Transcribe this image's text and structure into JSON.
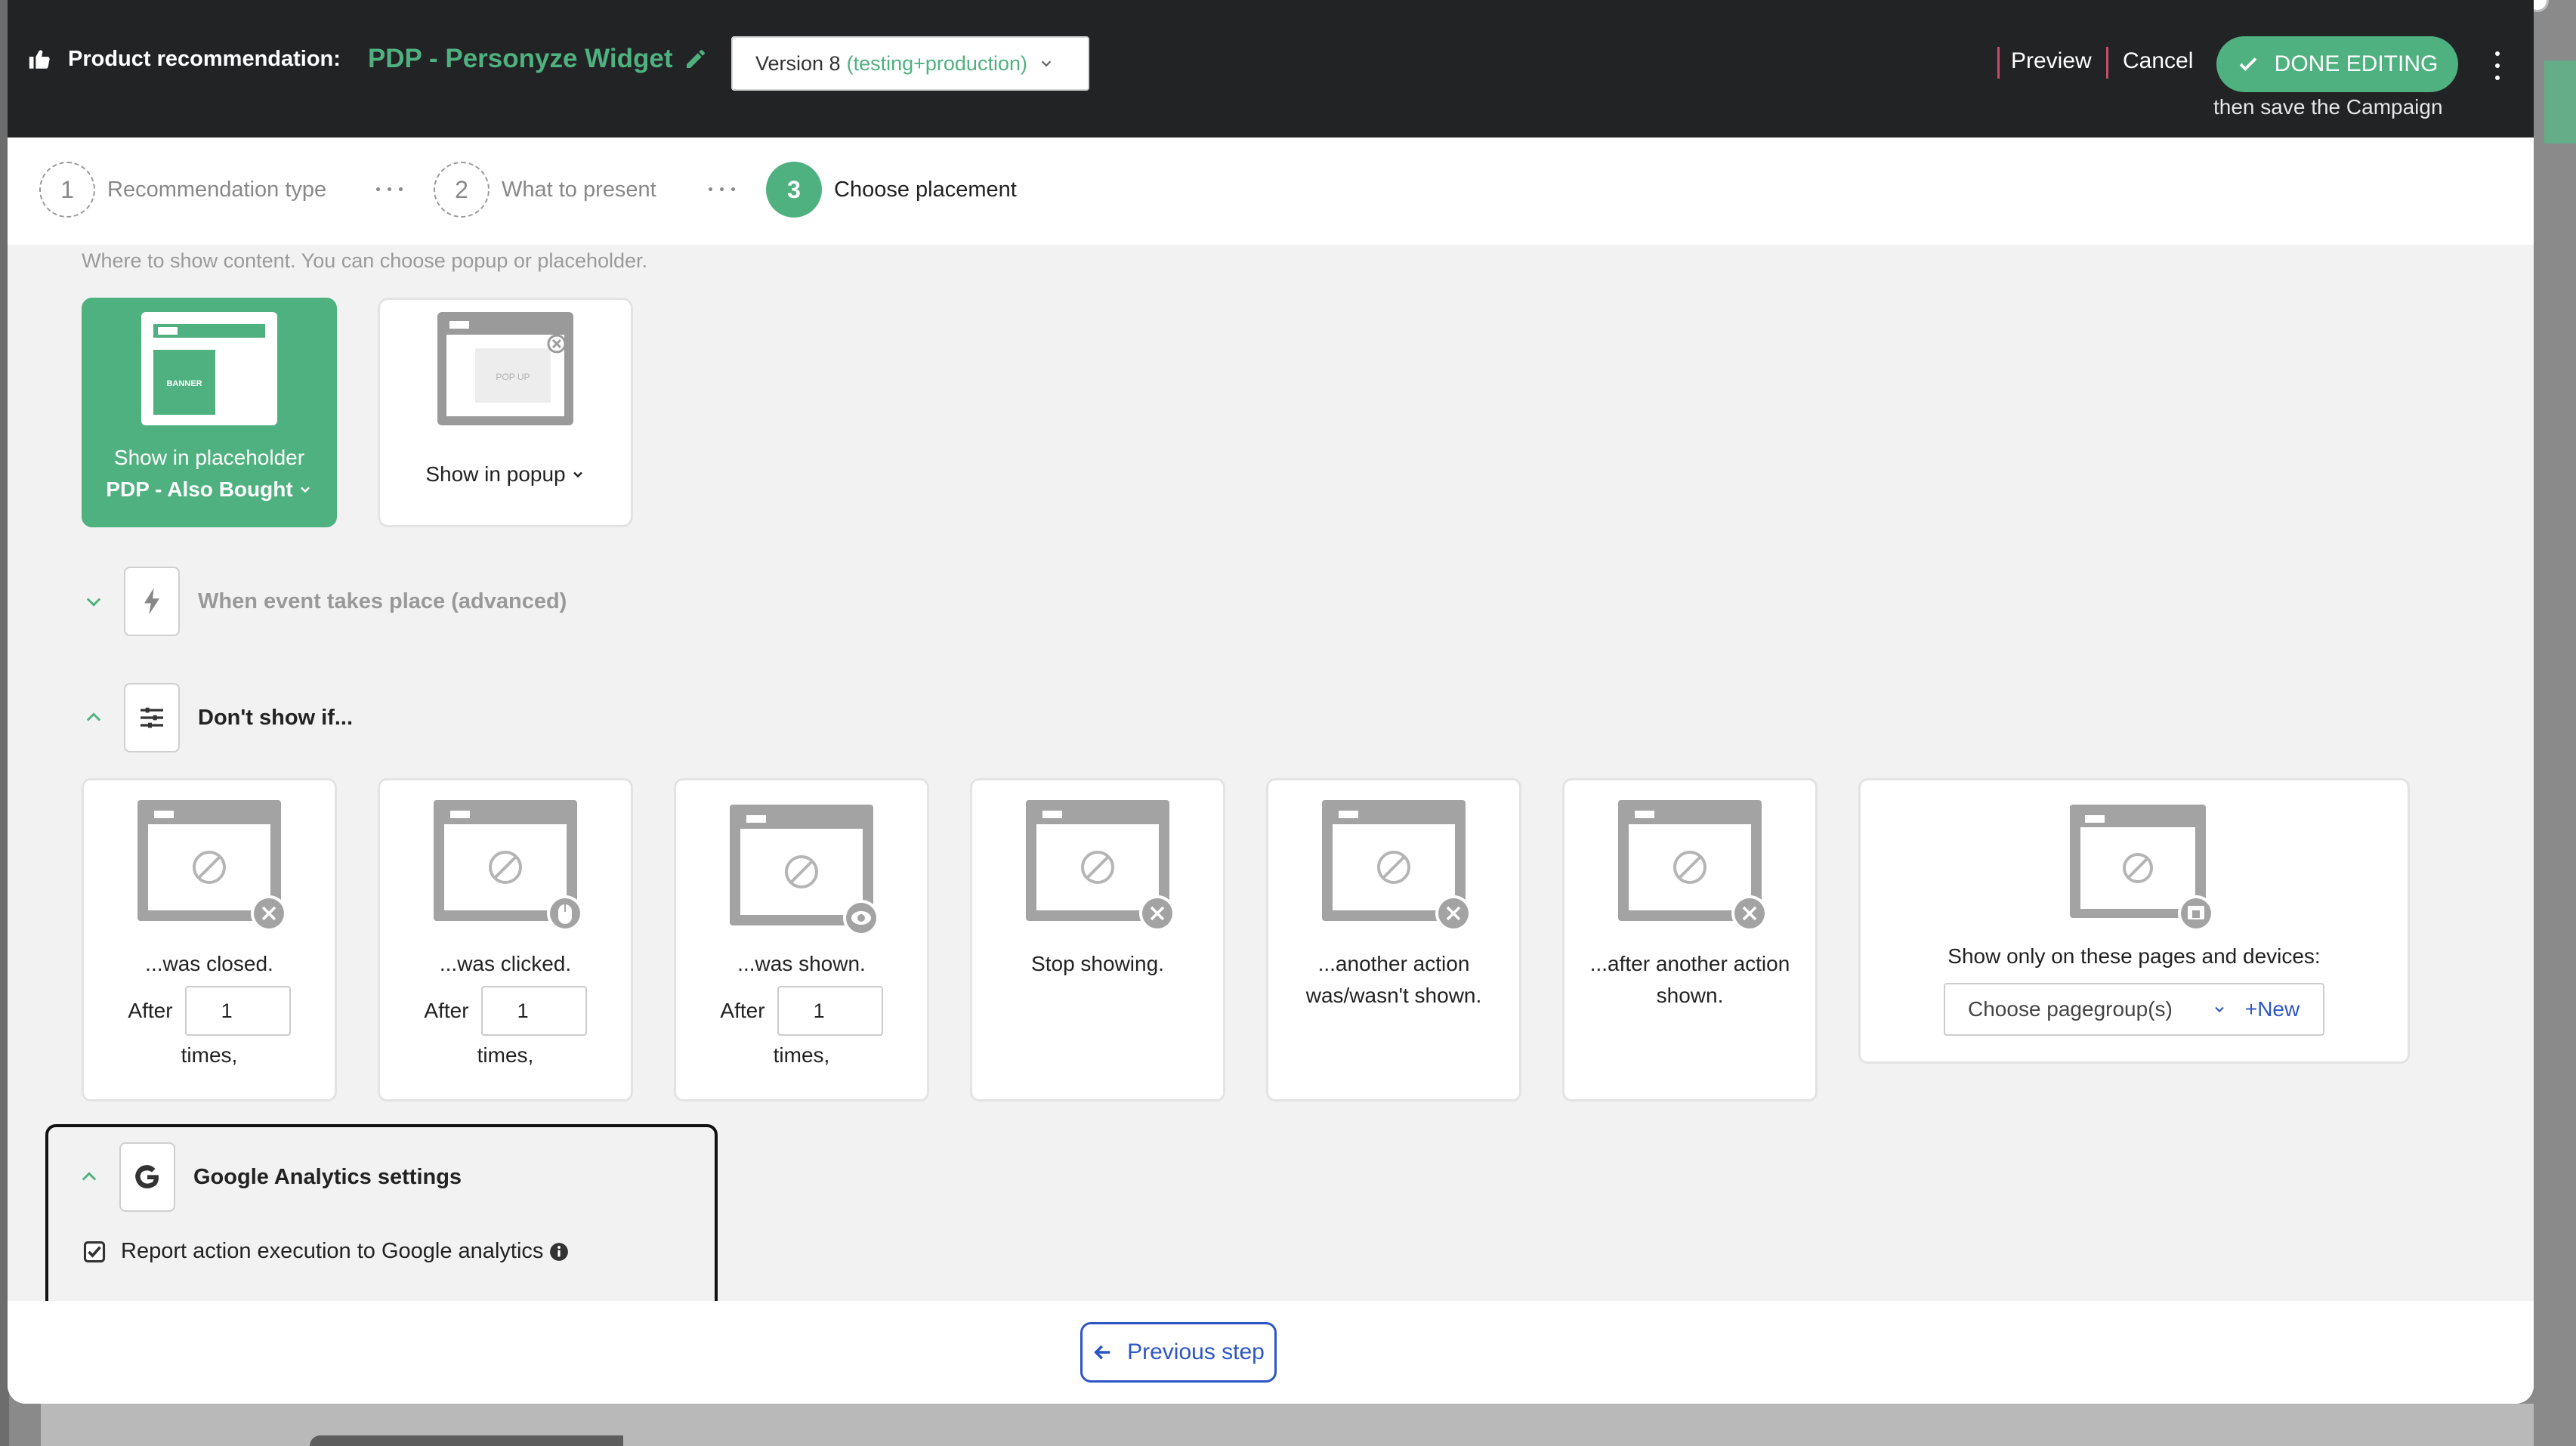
{
  "header": {
    "title_label": "Product recommendation:",
    "widget_name": "PDP - Personyze Widget",
    "version_label": "Version 8",
    "version_env": "(testing+production)",
    "preview": "Preview",
    "cancel": "Cancel",
    "done": "DONE EDITING",
    "save_hint": "then save the Campaign"
  },
  "steps": [
    {
      "num": "1",
      "label": "Recommendation type"
    },
    {
      "num": "2",
      "label": "What to present"
    },
    {
      "num": "3",
      "label": "Choose placement"
    }
  ],
  "placement": {
    "subtitle": "Where to show content. You can choose popup or placeholder.",
    "placeholder_label": "Show in placeholder",
    "placeholder_value": "PDP - Also Bought",
    "placeholder_graphic": "BANNER",
    "popup_label": "Show in popup",
    "popup_graphic": "POP UP"
  },
  "sections": {
    "event": "When event takes place (advanced)",
    "dont_show": "Don't show if...",
    "ga": "Google Analytics settings"
  },
  "conditions": [
    {
      "title": "...was closed.",
      "after": "After",
      "value": "1",
      "times": "times,",
      "badge": "close-icon"
    },
    {
      "title": "...was clicked.",
      "after": "After",
      "value": "1",
      "times": "times,",
      "badge": "mouse-icon"
    },
    {
      "title": "...was shown.",
      "after": "After",
      "value": "1",
      "times": "times,",
      "badge": "eye-icon"
    },
    {
      "title": "Stop showing.",
      "badge": "close-icon"
    },
    {
      "title": "...another action was/wasn't shown.",
      "badge": "close-icon"
    },
    {
      "title": "...after another action shown.",
      "badge": "close-icon"
    },
    {
      "title": "Show only on these pages and devices:",
      "select": "Choose pagegroup(s)",
      "new": "+New",
      "badge": "device-icon"
    }
  ],
  "ga": {
    "checkbox_label": "Report action execution to Google analytics",
    "checked": true
  },
  "footer": {
    "prev": "Previous step"
  },
  "colors": {
    "accent": "#4fb17f",
    "topbar": "#222325",
    "link": "#2d56c4"
  }
}
